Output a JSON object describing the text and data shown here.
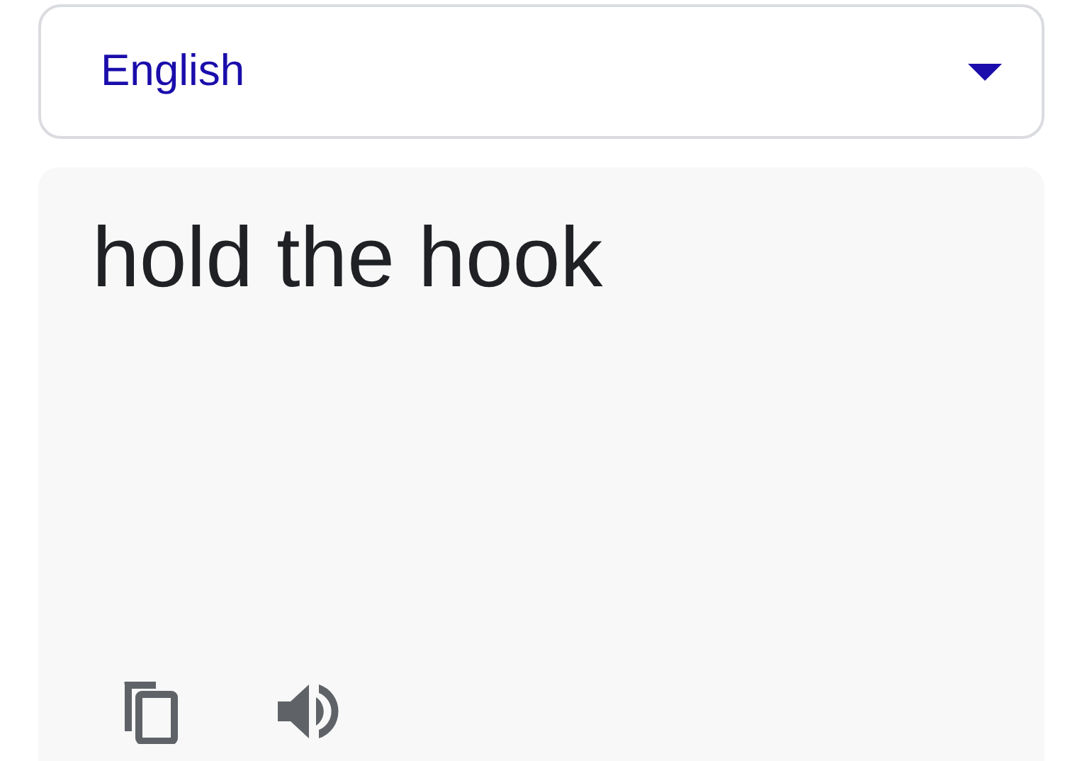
{
  "language_select": {
    "value": "English"
  },
  "output": {
    "text": "hold the hook"
  }
}
